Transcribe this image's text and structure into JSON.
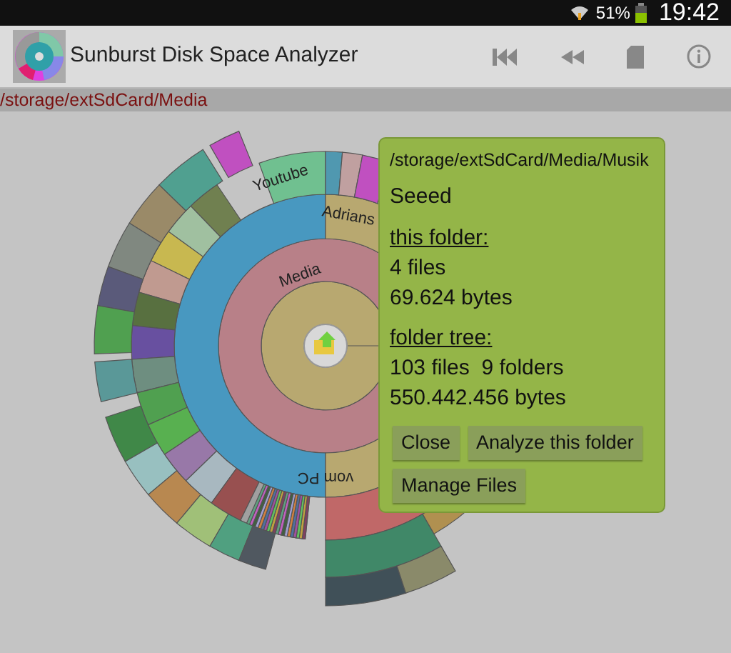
{
  "status_bar": {
    "battery": "51%",
    "time": "19:42"
  },
  "app_bar": {
    "title": "Sunburst Disk Space Analyzer"
  },
  "path": "/storage/extSdCard/Media",
  "chart_labels": [
    {
      "text": "Media"
    },
    {
      "text": "vom PC"
    },
    {
      "text": "Adrians"
    },
    {
      "text": "Youtube"
    }
  ],
  "popup": {
    "path": "/storage/extSdCard/Media/Musik",
    "name": "Seeed",
    "sections": [
      {
        "heading": "this folder:",
        "lines": [
          "4 files",
          "69.624 bytes"
        ]
      },
      {
        "heading": "folder tree:",
        "lines": [
          "103 files  9 folders",
          "550.442.456 bytes"
        ]
      }
    ],
    "buttons": [
      "Close",
      "Analyze this folder",
      "Manage Files"
    ]
  }
}
